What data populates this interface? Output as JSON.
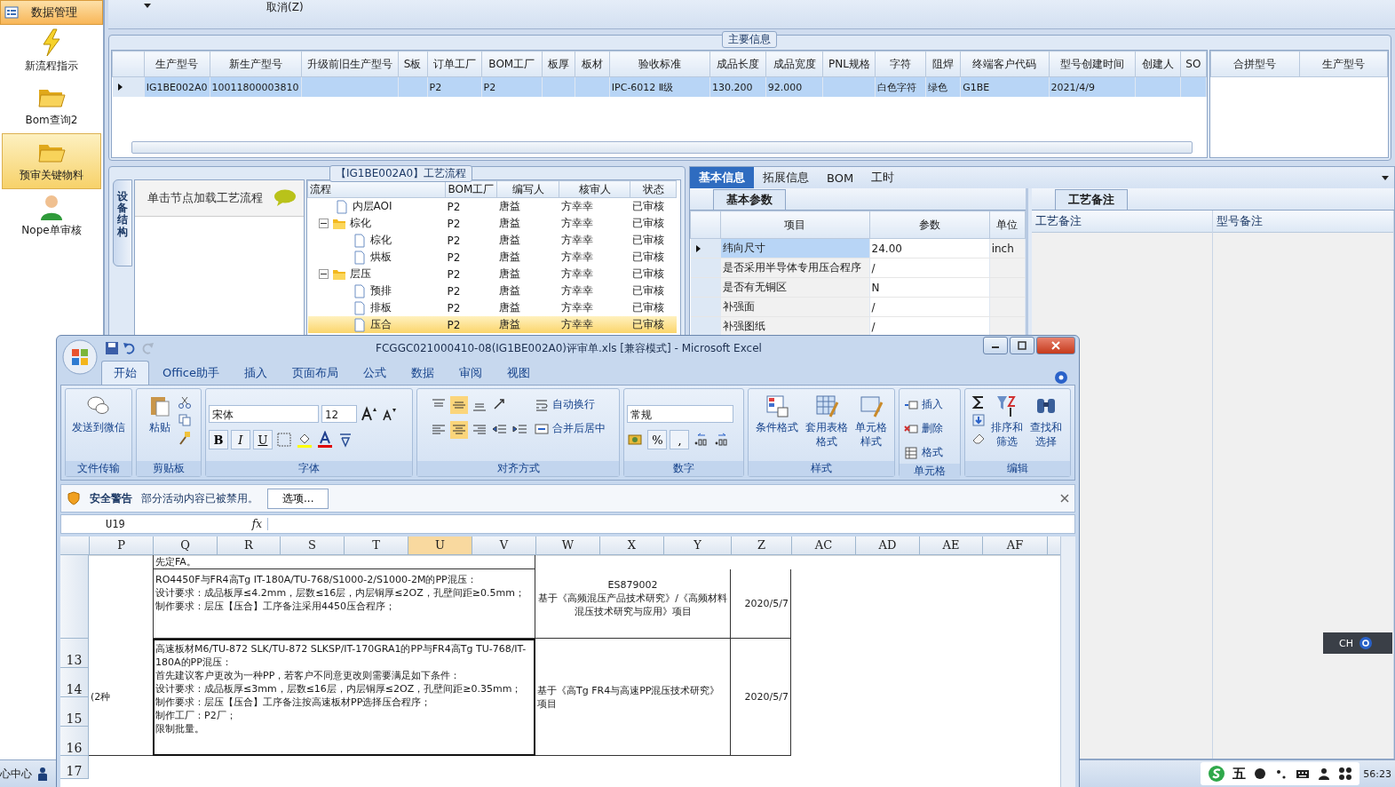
{
  "sidebar": {
    "header": "数据管理",
    "items": [
      {
        "label": "新流程指示",
        "kind": "bolt",
        "selected": false
      },
      {
        "label": "Bom查询2",
        "kind": "folder",
        "selected": false
      },
      {
        "label": "预审关键物料",
        "kind": "folder",
        "selected": true
      },
      {
        "label": "Nope单审核",
        "kind": "person",
        "selected": false
      }
    ]
  },
  "toolbar": {
    "cancel": "取消(Z)"
  },
  "main_info": {
    "title": "主要信息",
    "columns": [
      "生产型号",
      "新生产型号",
      "升级前旧生产型号",
      "S板",
      "订单工厂",
      "BOM工厂",
      "板厚",
      "板材",
      "验收标准",
      "成品长度",
      "成品宽度",
      "PNL规格",
      "字符",
      "阻焊",
      "终端客户代码",
      "型号创建时间",
      "创建人",
      "SO"
    ],
    "rows": [
      {
        "selected": true,
        "cells": [
          "IG1BE002A0",
          "10011800003810",
          "",
          "",
          "P2",
          "P2",
          "",
          "",
          "IPC-6012 Ⅱ级",
          "130.200",
          "92.000",
          "",
          "白色字符",
          "绿色",
          "G1BE",
          "2021/4/9",
          "",
          ""
        ]
      }
    ],
    "merge_columns": [
      "合拼型号",
      "生产型号"
    ]
  },
  "process": {
    "title": "【IG1BE002A0】工艺流程",
    "side_tab": "设备结构",
    "hint": "单击节点加载工艺流程",
    "columns": [
      "流程",
      "BOM工厂",
      "编写人",
      "核审人",
      "状态"
    ],
    "rows": [
      {
        "label": "内层AOI",
        "kind": "leaf",
        "factory": "P2",
        "writer": "唐益",
        "reviewer": "方幸幸",
        "status": "已审核",
        "selected": false
      },
      {
        "label": "棕化",
        "kind": "folder",
        "expanded": true,
        "factory": "P2",
        "writer": "唐益",
        "reviewer": "方幸幸",
        "status": "已审核",
        "selected": false,
        "children": [
          {
            "label": "棕化",
            "kind": "leaf",
            "factory": "P2",
            "writer": "唐益",
            "reviewer": "方幸幸",
            "status": "已审核",
            "selected": false
          },
          {
            "label": "烘板",
            "kind": "leaf",
            "factory": "P2",
            "writer": "唐益",
            "reviewer": "方幸幸",
            "status": "已审核",
            "selected": false
          }
        ]
      },
      {
        "label": "层压",
        "kind": "folder",
        "expanded": true,
        "factory": "P2",
        "writer": "唐益",
        "reviewer": "方幸幸",
        "status": "已审核",
        "selected": false,
        "children": [
          {
            "label": "预排",
            "kind": "leaf",
            "factory": "P2",
            "writer": "唐益",
            "reviewer": "方幸幸",
            "status": "已审核",
            "selected": false
          },
          {
            "label": "排板",
            "kind": "leaf",
            "factory": "P2",
            "writer": "唐益",
            "reviewer": "方幸幸",
            "status": "已审核",
            "selected": false
          },
          {
            "label": "压合",
            "kind": "leaf",
            "factory": "P2",
            "writer": "唐益",
            "reviewer": "方幸幸",
            "status": "已审核",
            "selected": true
          }
        ]
      }
    ]
  },
  "details": {
    "tabs": [
      {
        "label": "基本信息",
        "selected": true
      },
      {
        "label": "拓展信息",
        "selected": false
      },
      {
        "label": "BOM",
        "selected": false
      },
      {
        "label": "工时",
        "selected": false
      }
    ],
    "sub_tab": "基本参数",
    "columns": [
      "项目",
      "参数",
      "单位"
    ],
    "rows": [
      {
        "item": "纬向尺寸",
        "value": "24.00",
        "unit": "inch",
        "selected": true
      },
      {
        "item": "是否采用半导体专用压合程序",
        "value": "/",
        "unit": "",
        "selected": false
      },
      {
        "item": "是否有无铜区",
        "value": "N",
        "unit": "",
        "selected": false
      },
      {
        "item": "补强面",
        "value": "/",
        "unit": "",
        "selected": false
      },
      {
        "item": "补强图纸",
        "value": "/",
        "unit": "",
        "selected": false
      }
    ],
    "notes_tab": "工艺备注",
    "notes_columns": [
      "工艺备注",
      "型号备注"
    ]
  },
  "status_bar": {
    "left": "心中心",
    "time": "56:23",
    "ime": "五"
  },
  "language_bar": {
    "label": "CH"
  },
  "excel": {
    "title": "FCGGC021000410-08(IG1BE002A0)评审单.xls  [兼容模式] - Microsoft Excel",
    "tabs": [
      {
        "label": "开始",
        "selected": true
      },
      {
        "label": "Office助手",
        "selected": false
      },
      {
        "label": "插入",
        "selected": false
      },
      {
        "label": "页面布局",
        "selected": false
      },
      {
        "label": "公式",
        "selected": false
      },
      {
        "label": "数据",
        "selected": false
      },
      {
        "label": "审阅",
        "selected": false
      },
      {
        "label": "视图",
        "selected": false
      }
    ],
    "ribbon": {
      "groups": [
        "文件传输",
        "剪贴板",
        "字体",
        "对齐方式",
        "数字",
        "样式",
        "单元格",
        "编辑"
      ],
      "send": "发送到微信",
      "paste": "粘贴",
      "font_name": "宋体",
      "font_size": "12",
      "bold": "B",
      "italic": "I",
      "underline": "U",
      "wrap": "自动换行",
      "merge": "合并后居中",
      "number_format": "常规",
      "percent": "%",
      "comma": ",",
      "cond_format": "条件格式",
      "table_format": "套用表格格式",
      "cell_style": "单元格样式",
      "insert": "插入",
      "delete": "删除",
      "format": "格式",
      "sort": "排序和筛选",
      "find": "查找和选择"
    },
    "security": {
      "title": "安全警告",
      "message": "部分活动内容已被禁用。",
      "button": "选项..."
    },
    "name_box": "U19",
    "formula_label": "fx",
    "columns": [
      {
        "label": "P",
        "selected": false
      },
      {
        "label": "Q",
        "selected": false
      },
      {
        "label": "R",
        "selected": false
      },
      {
        "label": "S",
        "selected": false
      },
      {
        "label": "T",
        "selected": false
      },
      {
        "label": "U",
        "selected": true
      },
      {
        "label": "V",
        "selected": false
      },
      {
        "label": "W",
        "selected": false
      },
      {
        "label": "X",
        "selected": false
      },
      {
        "label": "Y",
        "selected": false
      },
      {
        "label": "Z",
        "selected": false
      },
      {
        "label": "AC",
        "selected": false
      },
      {
        "label": "AD",
        "selected": false
      },
      {
        "label": "AE",
        "selected": false
      },
      {
        "label": "AF",
        "selected": false
      }
    ],
    "row_numbers": [
      "13",
      "14",
      "15",
      "16",
      "17"
    ],
    "cells": [
      {
        "lines": [
          "先定FA。"
        ],
        "selected": false
      },
      {
        "lines": [
          "RO4450F与FR4高Tg IT-180A/TU-768/S1000-2/S1000-2M的PP混压：",
          "设计要求：成品板厚≤4.2mm，层数≤16层，内层铜厚≤2OZ，孔壁间距≥0.5mm；",
          "制作要求：层压【压合】工序备注采用4450压合程序；"
        ],
        "selected": false
      },
      {
        "lines": [
          "ES879002",
          "基于《高频混压产品技术研究》/《高频材料混压技术研究与应用》项目"
        ],
        "selected": false
      },
      {
        "lines": [
          "2020/5/7"
        ],
        "selected": false
      },
      {
        "lines": [
          "(2种"
        ],
        "selected": false
      },
      {
        "lines": [
          "高速板材M6/TU-872 SLK/TU-872 SLKSP/IT-170GRA1的PP与FR4高Tg TU-768/IT-180A的PP混压：",
          "首先建议客户更改为一种PP，若客户不同意更改则需要满足如下条件：",
          "设计要求：成品板厚≤3mm，层数≤16层，内层铜厚≤2OZ，孔壁间距≥0.35mm；",
          "制作要求：层压【压合】工序备注按高速板材PP选择压合程序；",
          "制作工厂：P2厂；",
          "限制批量。"
        ],
        "selected": true
      },
      {
        "lines": [
          "基于《高Tg FR4与高速PP混压技术研究》项目"
        ],
        "selected": false
      },
      {
        "lines": [
          "2020/5/7"
        ],
        "selected": false
      }
    ]
  }
}
